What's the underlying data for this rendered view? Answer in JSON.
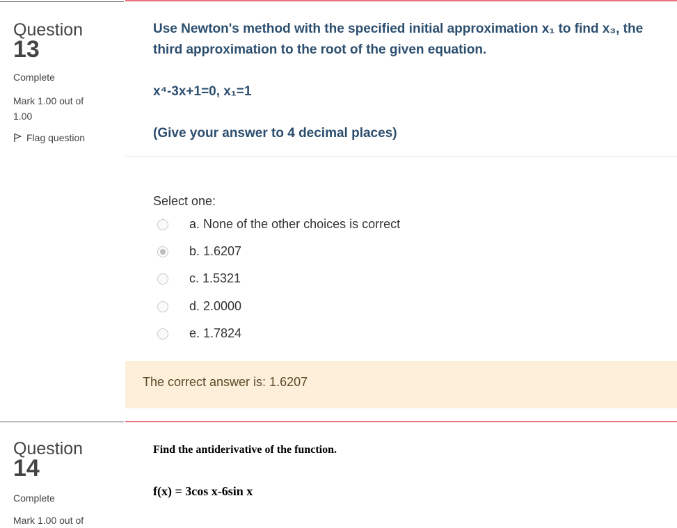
{
  "q13": {
    "word": "Question",
    "number": "13",
    "state": "Complete",
    "mark": "Mark 1.00 out of",
    "mark_total": "1.00",
    "flag": "Flag question",
    "text": "Use Newton's method with the specified initial approximation x₁ to find x₃, the third approximation to the root of the given equation.",
    "equation": "x⁴-3x+1=0, x₁=1",
    "hint": "(Give your answer to 4 decimal places)",
    "select": "Select one:",
    "options": [
      {
        "label": "a. None of the other choices is correct",
        "checked": false
      },
      {
        "label": "b. 1.6207",
        "checked": true
      },
      {
        "label": "c. 1.5321",
        "checked": false
      },
      {
        "label": "d. 2.0000",
        "checked": false
      },
      {
        "label": "e. 1.7824",
        "checked": false
      }
    ],
    "feedback": "The correct answer is: 1.6207"
  },
  "q14": {
    "word": "Question",
    "number": "14",
    "state": "Complete",
    "mark": "Mark 1.00 out of",
    "text": "Find the antiderivative of the function.",
    "equation": "f(x) = 3cos x-6sin x"
  },
  "colors": {
    "accent": "#e8707d",
    "question_text": "#2c4e6e",
    "feedback_bg": "#fdefd9"
  }
}
